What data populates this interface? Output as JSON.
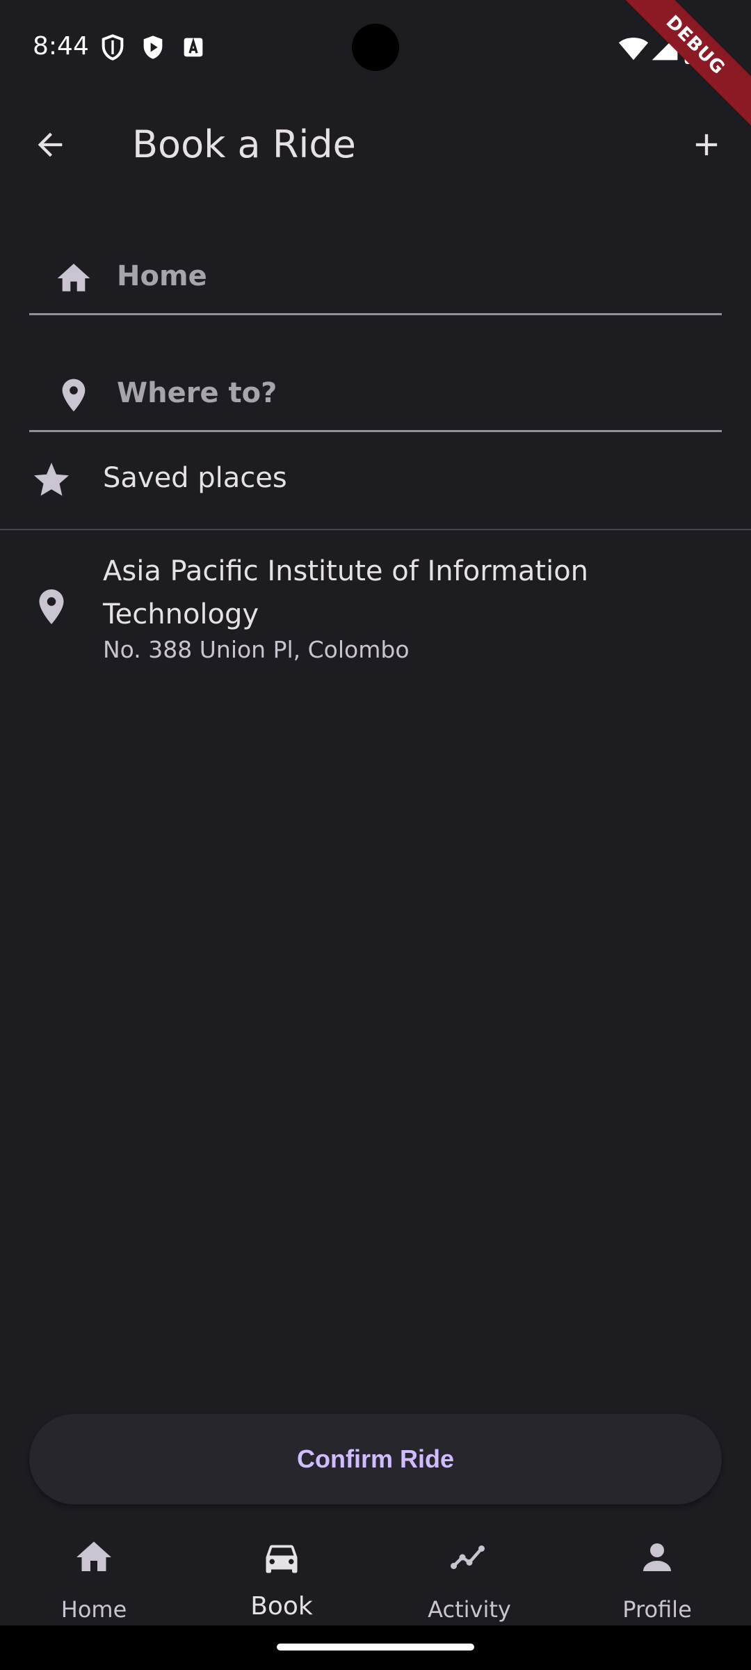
{
  "status_bar": {
    "time": "8:44",
    "icons": [
      "shield-icon",
      "play-protect-icon",
      "font-icon",
      "wifi-icon",
      "signal-icon",
      "battery-icon"
    ]
  },
  "debug_banner": "DEBUG",
  "app_bar": {
    "title": "Book a Ride",
    "back_icon": "arrow-back-icon",
    "action_icon": "add-icon"
  },
  "pickup": {
    "placeholder": "Home",
    "icon": "home-icon"
  },
  "destination": {
    "placeholder": "Where to?",
    "icon": "location-pin-icon"
  },
  "saved_places": {
    "label": "Saved places",
    "icon": "star-icon"
  },
  "places": [
    {
      "title": "Asia Pacific Institute of Information Technology",
      "address": "No. 388 Union Pl, Colombo",
      "icon": "location-pin-icon"
    }
  ],
  "confirm_button": "Confirm Ride",
  "bottom_nav": {
    "items": [
      {
        "label": "Home",
        "icon": "home-icon",
        "active": false
      },
      {
        "label": "Book",
        "icon": "car-icon",
        "active": true
      },
      {
        "label": "Activity",
        "icon": "activity-icon",
        "active": false
      },
      {
        "label": "Profile",
        "icon": "person-icon",
        "active": false
      }
    ]
  },
  "colors": {
    "background": "#1d1c21",
    "accent": "#d0bcff",
    "text_primary": "#e6e1e5",
    "text_secondary": "#cac4d0",
    "divider": "#938f99"
  }
}
